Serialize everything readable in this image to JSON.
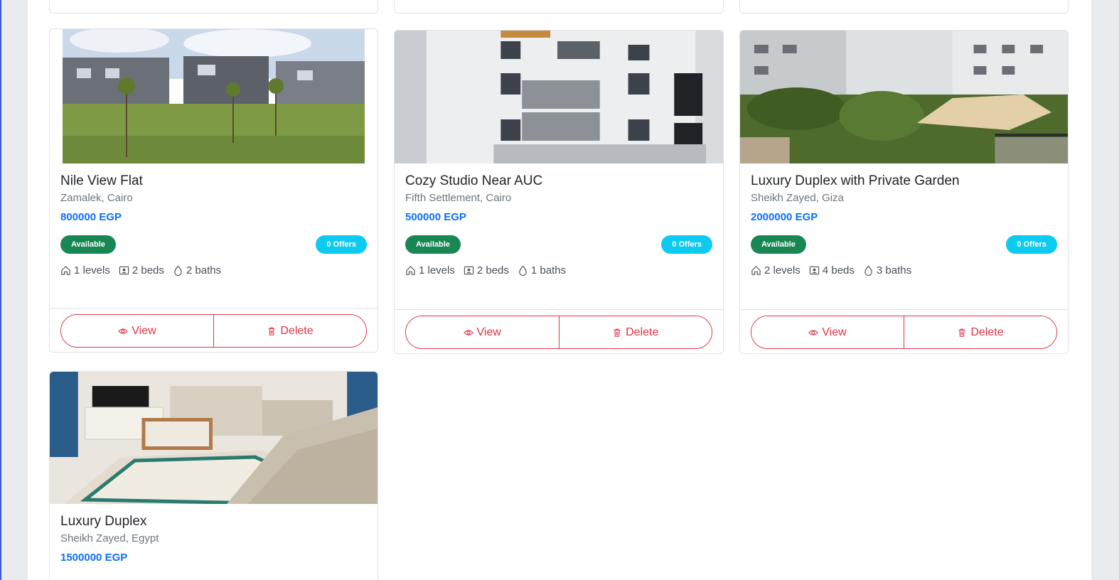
{
  "cards": [
    {
      "title": "Nile View Flat",
      "location": "Zamalek, Cairo",
      "price": "800000 EGP",
      "status": "Available",
      "offers": "0 Offers",
      "levels": "1 levels",
      "beds": "2 beds",
      "baths": "2 baths",
      "view": "View",
      "delete": "Delete"
    },
    {
      "title": "Cozy Studio Near AUC",
      "location": "Fifth Settlement, Cairo",
      "price": "500000 EGP",
      "status": "Available",
      "offers": "0 Offers",
      "levels": "1 levels",
      "beds": "2 beds",
      "baths": "1 baths",
      "view": "View",
      "delete": "Delete"
    },
    {
      "title": "Luxury Duplex with Private Garden",
      "location": "Sheikh Zayed, Giza",
      "price": "2000000 EGP",
      "status": "Available",
      "offers": "0 Offers",
      "levels": "2 levels",
      "beds": "4 beds",
      "baths": "3 baths",
      "view": "View",
      "delete": "Delete"
    },
    {
      "title": "Luxury Duplex",
      "location": "Sheikh Zayed, Egypt",
      "price": "1500000 EGP"
    }
  ],
  "icons": {
    "view": "eye-icon",
    "delete": "trash-icon",
    "levels": "house-icon",
    "beds": "person-badge-icon",
    "baths": "droplet-icon"
  },
  "colors": {
    "accent": "#0d6efd",
    "danger": "#dc3545",
    "success": "#198754",
    "info": "#0dcaf0"
  }
}
